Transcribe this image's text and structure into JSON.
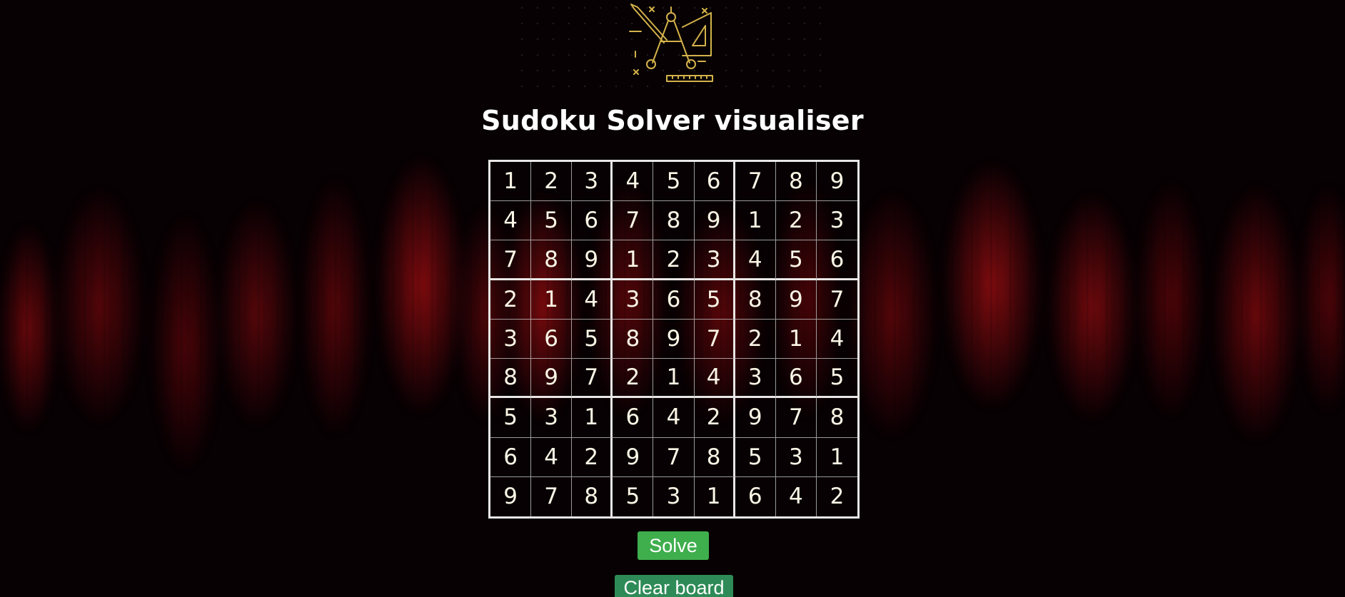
{
  "header": {
    "logo_icon": "drafting-tools-icon",
    "title": "Sudoku Solver visualiser"
  },
  "board": {
    "rows": [
      [
        "1",
        "2",
        "3",
        "4",
        "5",
        "6",
        "7",
        "8",
        "9"
      ],
      [
        "4",
        "5",
        "6",
        "7",
        "8",
        "9",
        "1",
        "2",
        "3"
      ],
      [
        "7",
        "8",
        "9",
        "1",
        "2",
        "3",
        "4",
        "5",
        "6"
      ],
      [
        "2",
        "1",
        "4",
        "3",
        "6",
        "5",
        "8",
        "9",
        "7"
      ],
      [
        "3",
        "6",
        "5",
        "8",
        "9",
        "7",
        "2",
        "1",
        "4"
      ],
      [
        "8",
        "9",
        "7",
        "2",
        "1",
        "4",
        "3",
        "6",
        "5"
      ],
      [
        "5",
        "3",
        "1",
        "6",
        "4",
        "2",
        "9",
        "7",
        "8"
      ],
      [
        "6",
        "4",
        "2",
        "9",
        "7",
        "8",
        "5",
        "3",
        "1"
      ],
      [
        "9",
        "7",
        "8",
        "5",
        "3",
        "1",
        "6",
        "4",
        "2"
      ]
    ]
  },
  "actions": {
    "solve_label": "Solve",
    "clear_label": "Clear board"
  },
  "colors": {
    "background": "#070103",
    "accent_red": "#8c0a0e",
    "grid_line": "#e9e6e6",
    "digit": "#fbf6e6",
    "logo_gold": "#d4b24a",
    "solve_button": "#3fae4d",
    "clear_button": "#2e8b57"
  }
}
